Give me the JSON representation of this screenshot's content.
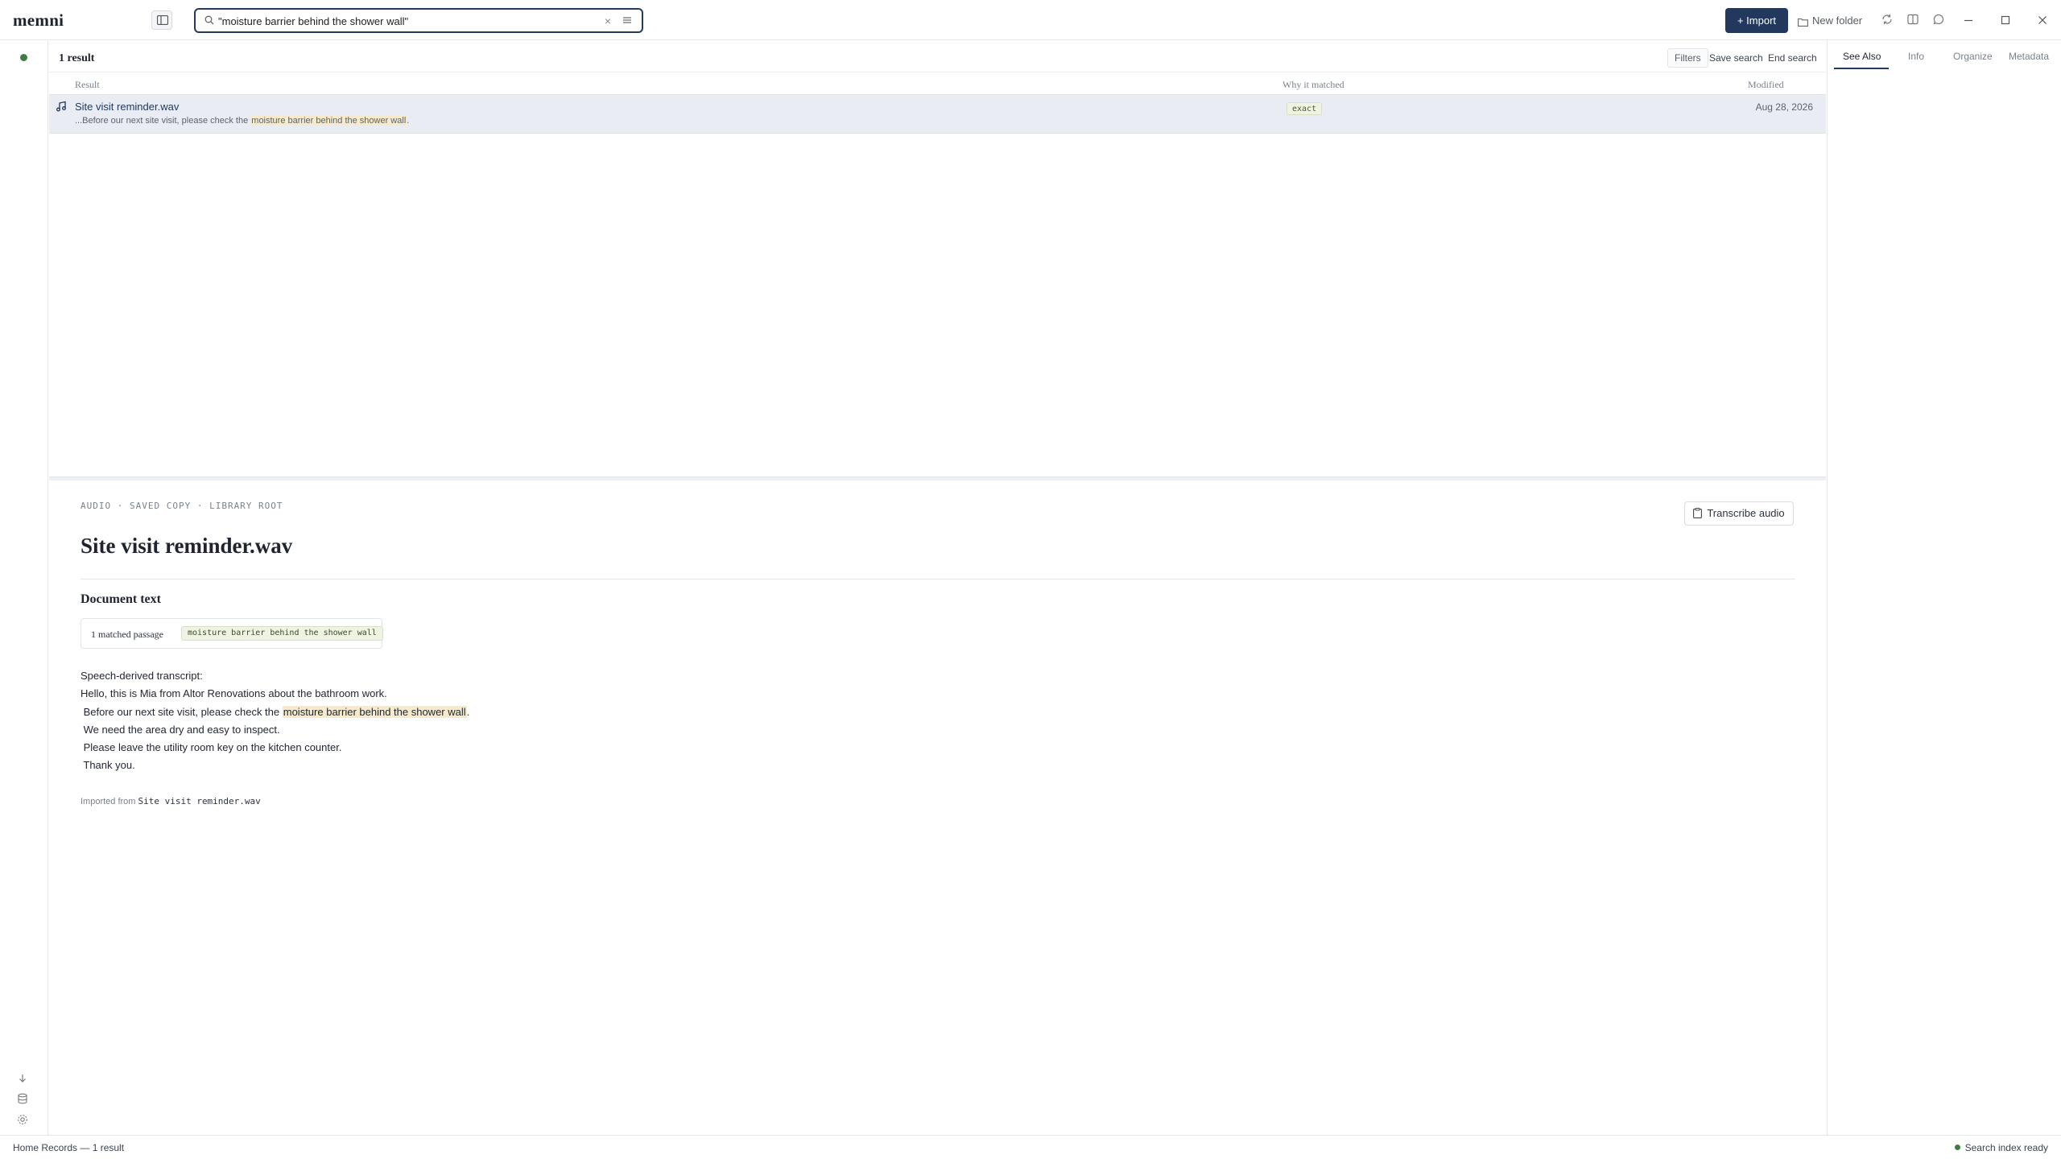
{
  "app": {
    "logo": "memni"
  },
  "search": {
    "value": "\"moisture barrier behind the shower wall\"",
    "clear_glyph": "×"
  },
  "toolbar": {
    "import_label": "+ Import",
    "new_folder_label": "New folder"
  },
  "results": {
    "count_label": "1 result",
    "filters_label": "Filters",
    "save_search_label": "Save search",
    "end_search_label": "End search",
    "columns": {
      "result": "Result",
      "why": "Why it matched",
      "modified": "Modified"
    },
    "rows": [
      {
        "title": "Site visit reminder.wav",
        "snippet_before": "...Before our next site visit, please check the ",
        "snippet_match": "moisture barrier behind the shower wall",
        "snippet_after": ".",
        "match_type": "exact",
        "modified": "Aug 28, 2026",
        "icon": "music-note-icon"
      }
    ]
  },
  "detail": {
    "meta": "AUDIO · SAVED COPY · LIBRARY ROOT",
    "transcribe_label": "Transcribe audio",
    "title": "Site visit reminder.wav",
    "doc_text_heading": "Document text",
    "matched_label": "1 matched passage",
    "matched_chip": "moisture barrier behind the shower wall",
    "transcript": {
      "line1": "Speech-derived transcript:",
      "line2": "Hello, this is Mia from Altor Renovations about the bathroom work.",
      "line3_before": " Before our next site visit, please check the ",
      "line3_match": "moisture barrier behind the shower wall",
      "line3_after": ".",
      "line4": " We need the area dry and easy to inspect.",
      "line5": " Please leave the utility room key on the kitchen counter.",
      "line6": " Thank you."
    },
    "imported_from_label": "Imported from",
    "imported_from_file": "Site visit reminder.wav"
  },
  "right_panel": {
    "tabs": [
      "See Also",
      "Info",
      "Organize",
      "Metadata"
    ],
    "active_tab": "See Also"
  },
  "status": {
    "left": "Home Records — 1 result",
    "right": "Search index ready"
  },
  "colors": {
    "accent": "#22385d",
    "highlight": "#f6eacb",
    "ready": "#3f7a47"
  }
}
